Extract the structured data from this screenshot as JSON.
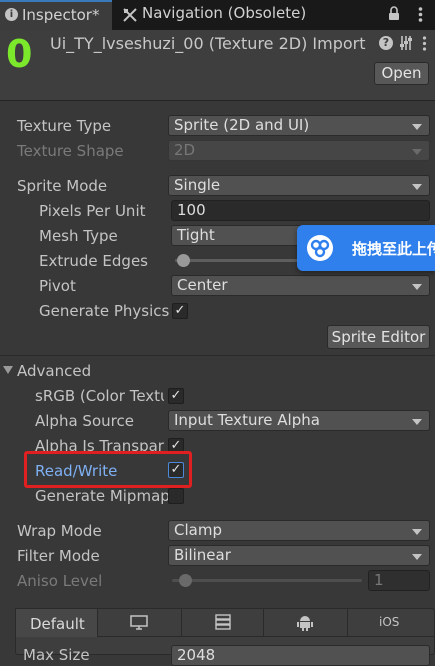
{
  "tabs": {
    "inspector": "Inspector*",
    "navigation": "Navigation (Obsolete)"
  },
  "header": {
    "count": "0",
    "title": "Ui_TY_lvseshuzi_00 (Texture 2D) Import",
    "open_label": "Open"
  },
  "props": {
    "texture_type": {
      "label": "Texture Type",
      "value": "Sprite (2D and UI)"
    },
    "texture_shape": {
      "label": "Texture Shape",
      "value": "2D"
    },
    "sprite_mode": {
      "label": "Sprite Mode",
      "value": "Single"
    },
    "pixels_per_unit": {
      "label": "Pixels Per Unit",
      "value": "100"
    },
    "mesh_type": {
      "label": "Mesh Type",
      "value": "Tight"
    },
    "extrude_edges": {
      "label": "Extrude Edges"
    },
    "pivot": {
      "label": "Pivot",
      "value": "Center"
    },
    "generate_physics": {
      "label": "Generate Physics"
    },
    "sprite_editor": "Sprite Editor"
  },
  "advanced": {
    "label": "Advanced",
    "srgb": "sRGB (Color Textu",
    "alpha_source": {
      "label": "Alpha Source",
      "value": "Input Texture Alpha"
    },
    "alpha_transparent": "Alpha Is Transpare",
    "read_write": "Read/Write",
    "generate_mipmap": "Generate Mipmap"
  },
  "wrap": {
    "wrap_mode": {
      "label": "Wrap Mode",
      "value": "Clamp"
    },
    "filter_mode": {
      "label": "Filter Mode",
      "value": "Bilinear"
    },
    "aniso": {
      "label": "Aniso Level",
      "value": "1"
    }
  },
  "platform_tabs": {
    "default": "Default",
    "ios": "iOS"
  },
  "bottom": {
    "max_size_label": "Max Size",
    "max_size_value": "2048"
  },
  "popup": {
    "text": "拖拽至此上传"
  },
  "colors": {
    "accent_blue": "#2f80ed",
    "highlight_red": "#e02020",
    "green_count": "#7ce82c"
  }
}
